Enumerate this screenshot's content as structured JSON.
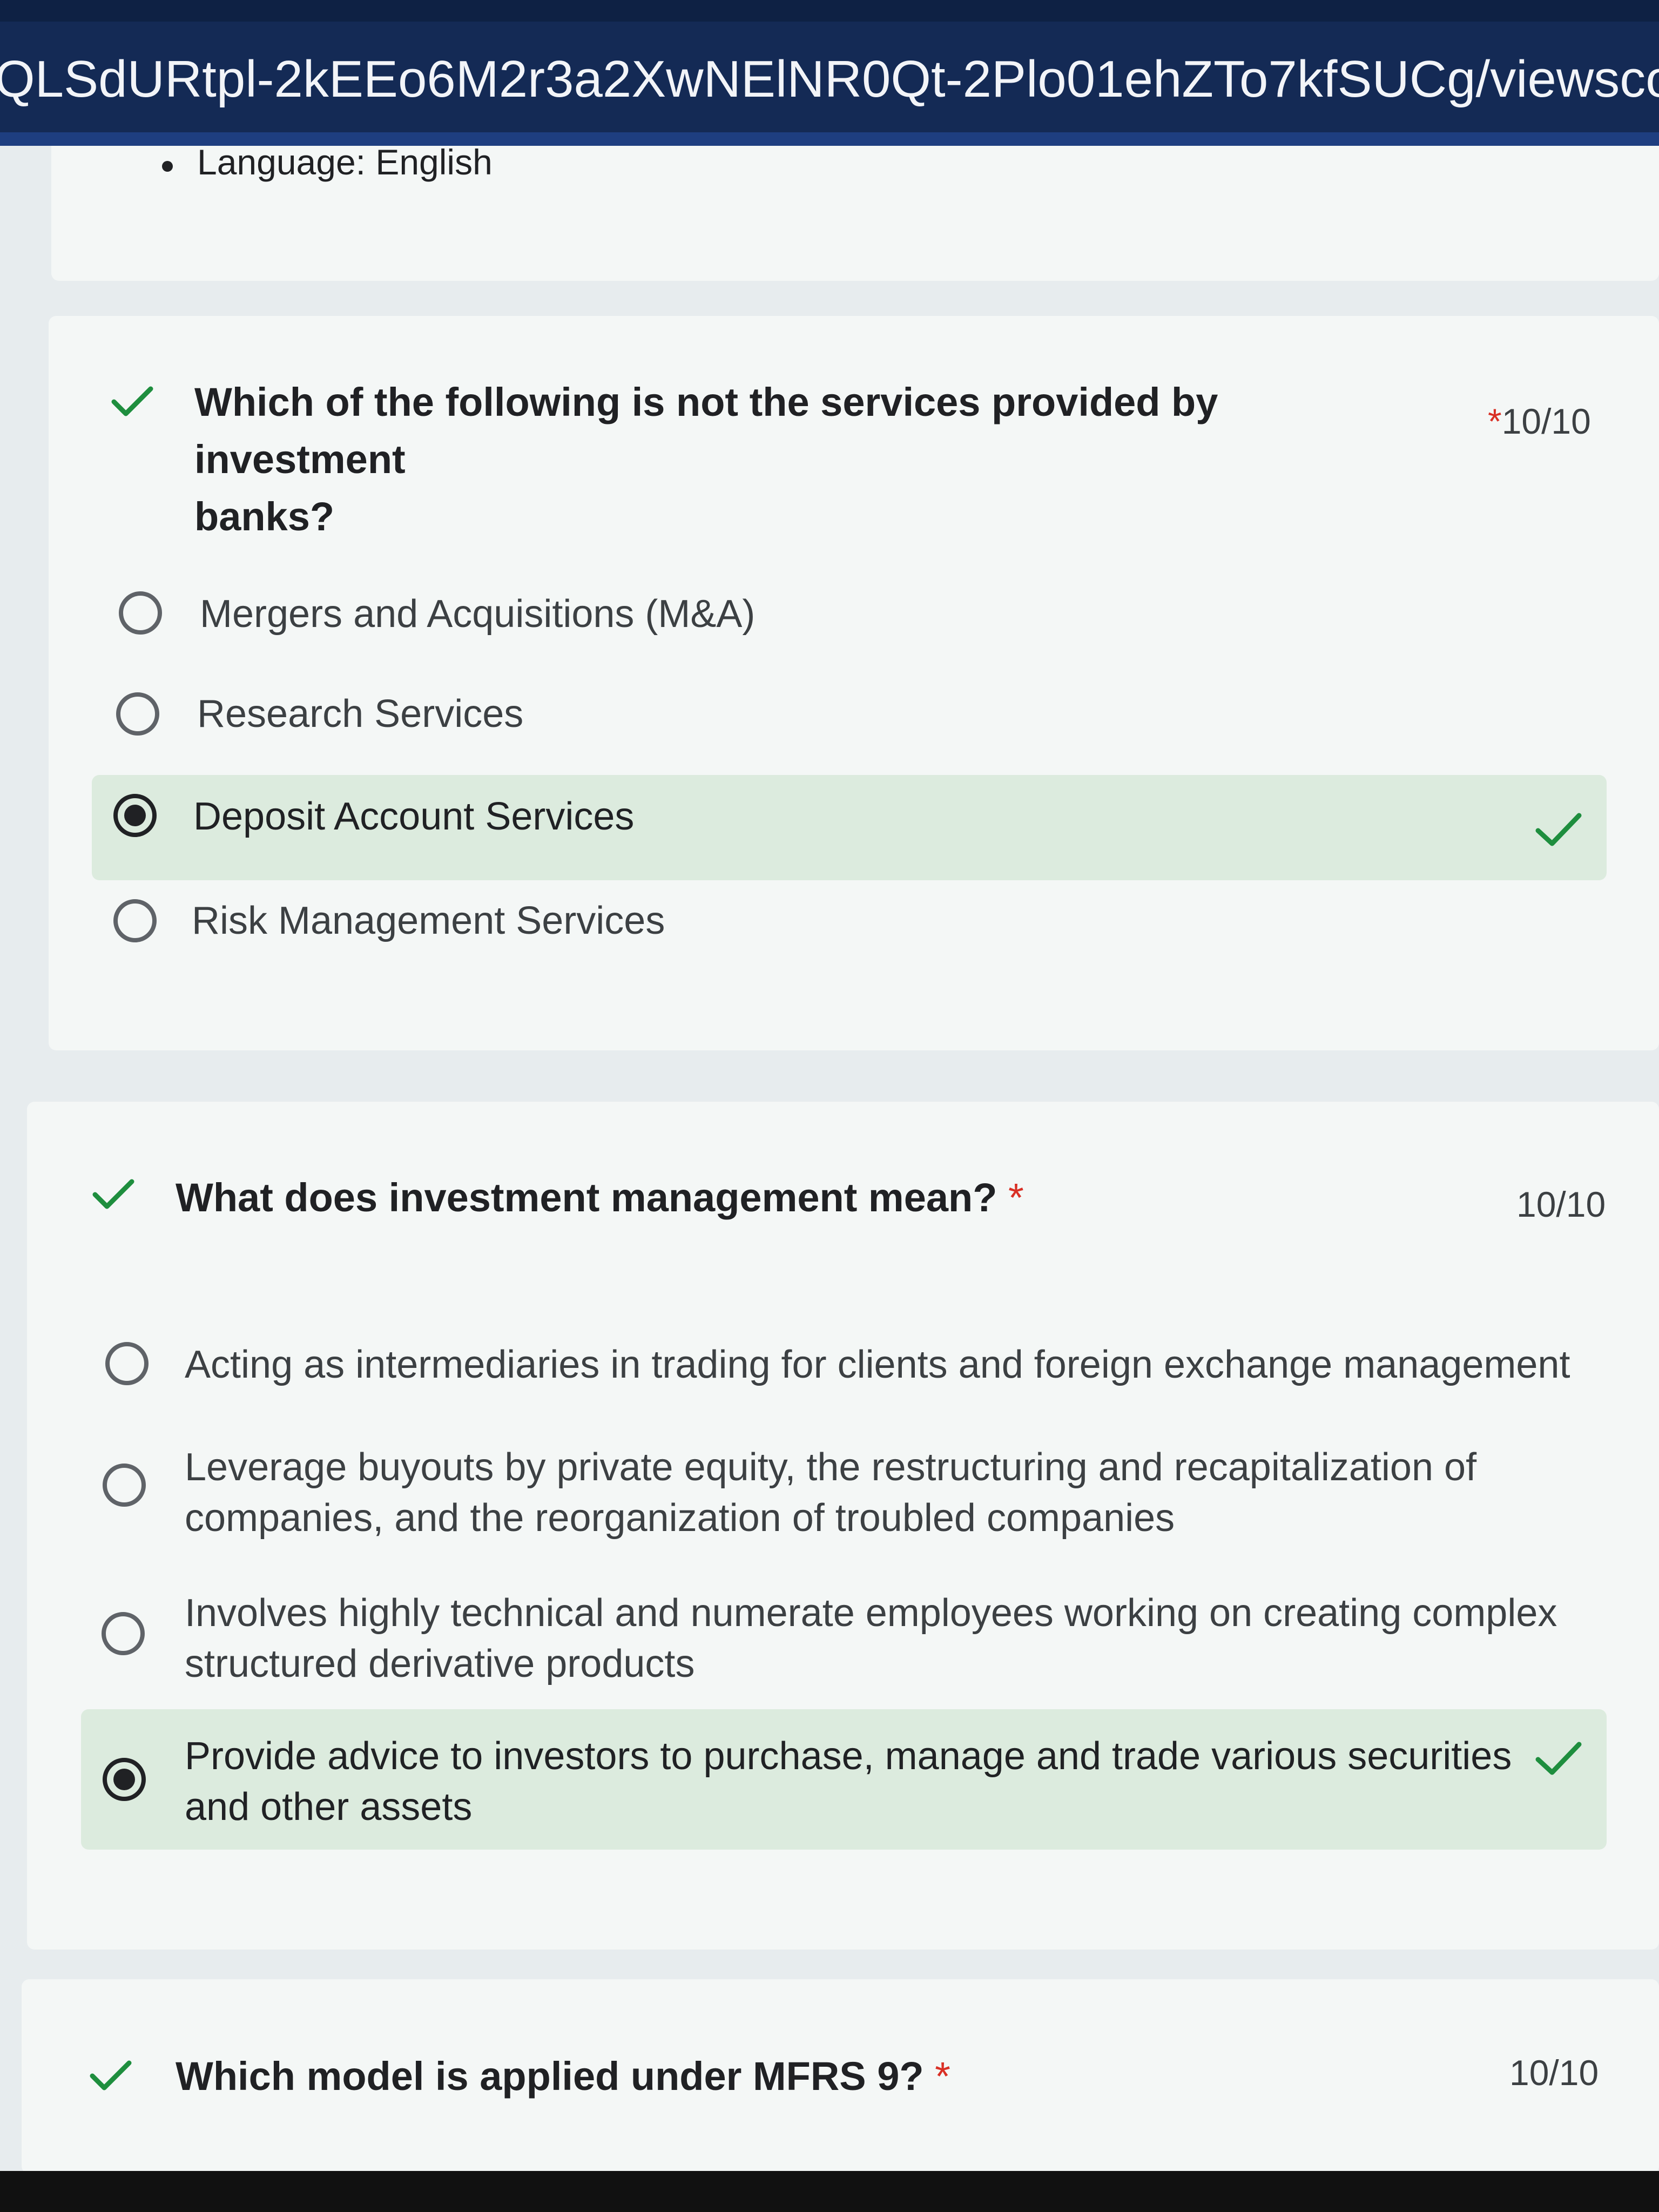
{
  "browser": {
    "url": "QLSdURtpl-2kEEo6M2r3a2XwNElNR0Qt-2Plo01ehZTo7kfSUCg/viewscore?viewsco"
  },
  "language_item": "Language: English",
  "questions": [
    {
      "title": "Which of the following is not the services provided by investment banks?",
      "title_line1": "Which of the following is not the services provided by investment",
      "title_line2": "banks?",
      "required_marker": "*",
      "score": "10/10",
      "options": [
        {
          "label": "Mergers and Acquisitions (M&A)",
          "selected": false,
          "correct": false
        },
        {
          "label": "Research Services",
          "selected": false,
          "correct": false
        },
        {
          "label": "Deposit Account Services",
          "selected": true,
          "correct": true
        },
        {
          "label": "Risk Management Services",
          "selected": false,
          "correct": false
        }
      ]
    },
    {
      "title": "What does investment management mean?",
      "required_marker": "*",
      "score": "10/10",
      "options": [
        {
          "label": "Acting as intermediaries in trading for clients and foreign exchange management",
          "selected": false,
          "correct": false
        },
        {
          "label": "Leverage buyouts by private equity, the restructuring and recapitalization of companies, and the reorganization of troubled companies",
          "line1": "Leverage buyouts by private equity, the restructuring and recapitalization of",
          "line2": "companies, and the reorganization of troubled companies",
          "selected": false,
          "correct": false
        },
        {
          "label": "Involves highly technical and numerate employees working on creating complex structured derivative products",
          "line1": "Involves highly technical and numerate employees working on creating complex",
          "line2": "structured derivative products",
          "selected": false,
          "correct": false
        },
        {
          "label": "Provide advice to investors to purchase, manage and trade various securities and other assets",
          "line1": "Provide advice to investors to purchase, manage and trade various securities",
          "line2": "and other assets",
          "selected": true,
          "correct": true
        }
      ]
    },
    {
      "title": "Which model is applied under MFRS 9?",
      "required_marker": "*",
      "score": "10/10"
    }
  ],
  "colors": {
    "correct_green": "#1e8e3e",
    "correct_bg": "#dcebde",
    "required_red": "#d93025",
    "browser_bar": "#142a55"
  },
  "icons": {
    "question_status": "checkmark-icon",
    "answer_correct": "checkmark-icon"
  }
}
